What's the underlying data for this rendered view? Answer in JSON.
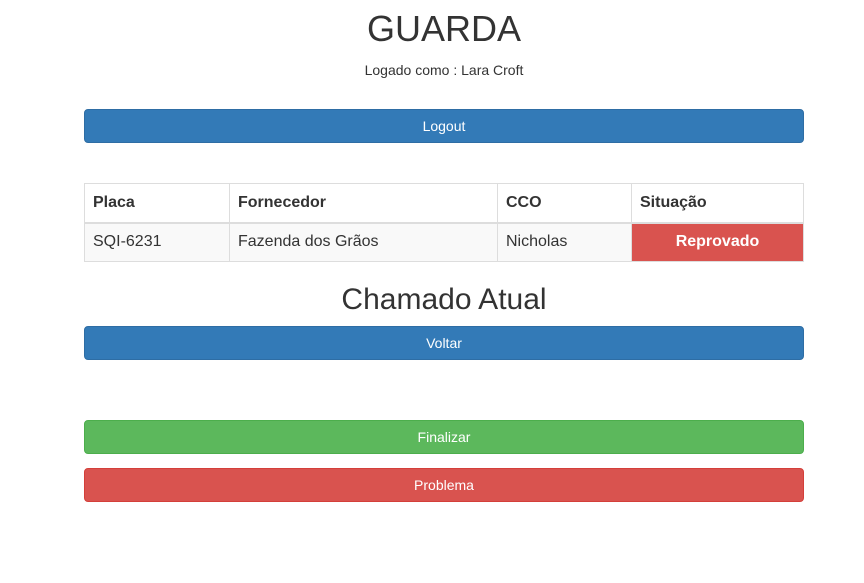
{
  "header": {
    "title": "GUARDA",
    "logged_in_text": "Logado como : Lara Croft"
  },
  "buttons": {
    "logout": "Logout",
    "voltar": "Voltar",
    "finalizar": "Finalizar",
    "problema": "Problema"
  },
  "table": {
    "columns": [
      "Placa",
      "Fornecedor",
      "CCO",
      "Situação"
    ],
    "rows": [
      {
        "placa": "SQI-6231",
        "fornecedor": "Fazenda dos Grãos",
        "cco": "Nicholas",
        "situacao": "Reprovado"
      }
    ]
  },
  "section": {
    "title": "Chamado Atual"
  },
  "colors": {
    "primary": "#337ab7",
    "success": "#5cb85c",
    "danger": "#d9534f"
  }
}
